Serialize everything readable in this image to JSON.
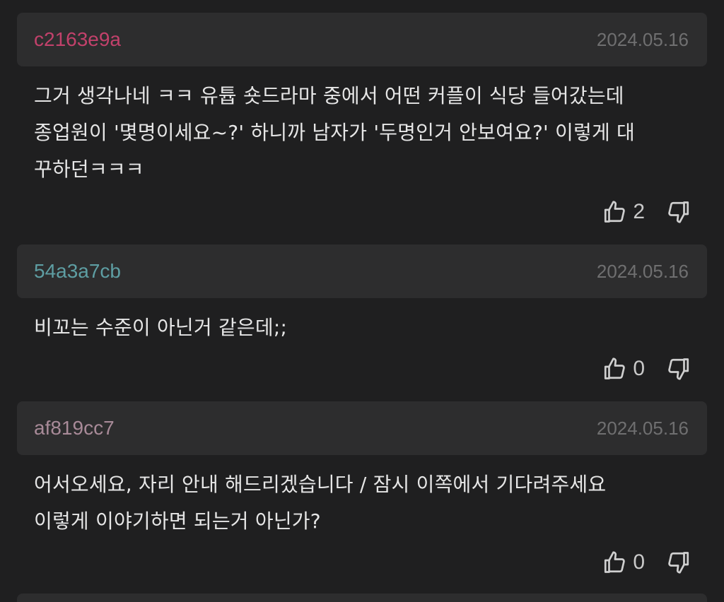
{
  "comments": [
    {
      "author": "c2163e9a",
      "author_color": "#c2416b",
      "date": "2024.05.16",
      "lines": [
        "그거 생각나네 ㅋㅋ 유튭 숏드라마 중에서 어떤 커플이 식당 들어갔는데",
        "종업원이 '몇명이세요~?' 하니까 남자가 '두명인거 안보여요?' 이렇게 대",
        "꾸하던ㅋㅋㅋ"
      ],
      "likes": "2",
      "like_icon": "thumbs-up-icon",
      "dislike_icon": "thumbs-down-icon"
    },
    {
      "author": "54a3a7cb",
      "author_color": "#5e9ea3",
      "date": "2024.05.16",
      "lines": [
        "비꼬는 수준이 아닌거 같은데;;"
      ],
      "likes": "0",
      "like_icon": "thumbs-up-icon",
      "dislike_icon": "thumbs-down-icon"
    },
    {
      "author": "af819cc7",
      "author_color": "#a88a98",
      "date": "2024.05.16",
      "lines": [
        "어서오세요, 자리 안내 해드리겠습니다 / 잠시 이쪽에서 기다려주세요",
        "이렇게 이야기하면 되는거 아닌가?"
      ],
      "likes": "0",
      "like_icon": "thumbs-up-icon",
      "dislike_icon": "thumbs-down-icon"
    }
  ],
  "colors": {
    "background": "#1f1f20",
    "header_bg": "#2d2d2e",
    "body_text": "#e6e6e6",
    "date_text": "#6f6f70",
    "icon": "#cfcfcf"
  }
}
